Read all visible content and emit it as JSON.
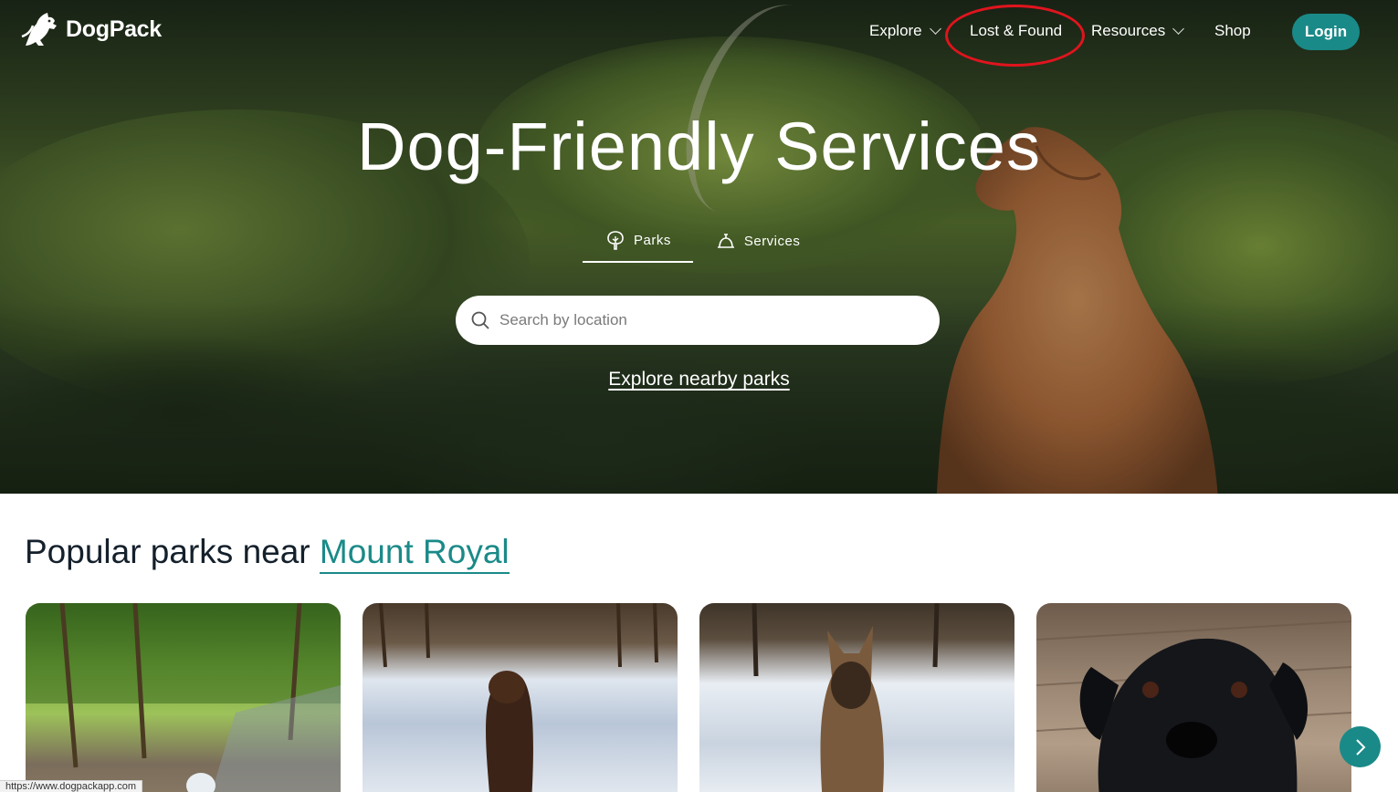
{
  "brand": {
    "name": "DogPack"
  },
  "nav": {
    "explore": "Explore",
    "lost_found": "Lost & Found",
    "resources": "Resources",
    "shop": "Shop",
    "login": "Login"
  },
  "hero": {
    "title": "Dog-Friendly Services",
    "tabs": [
      {
        "label": "Parks",
        "icon": "tree-icon",
        "active": true
      },
      {
        "label": "Services",
        "icon": "service-bell-icon",
        "active": false
      }
    ],
    "search_placeholder": "Search by location",
    "explore_link": "Explore nearby parks"
  },
  "popular": {
    "title_prefix": "Popular parks near",
    "location": "Mount Royal",
    "cards": [
      {
        "icon": "park-photo"
      },
      {
        "icon": "dog-snow-photo"
      },
      {
        "icon": "dog-snow-photo"
      },
      {
        "icon": "dog-portrait-photo"
      }
    ]
  },
  "status_bar": {
    "url": "https://www.dogpackapp.com"
  },
  "colors": {
    "accent": "#1a8a88",
    "annotation": "#e0141e",
    "text_dark": "#14202b"
  }
}
